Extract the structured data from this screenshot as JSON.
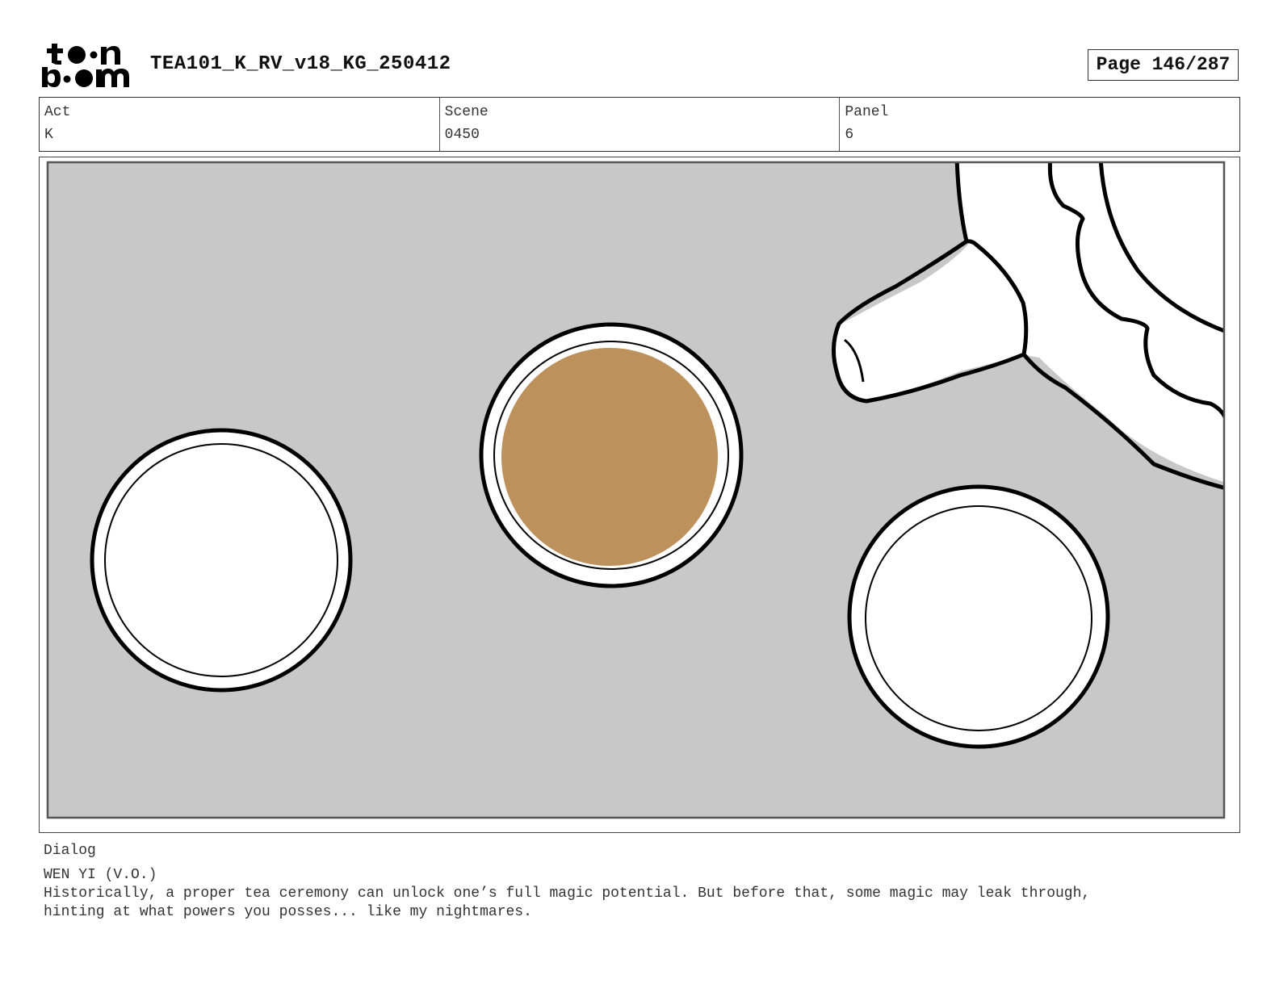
{
  "header": {
    "logo_text": "toon boom",
    "document_title": "TEA101_K_RV_v18_KG_250412",
    "page_indicator": "Page 146/287"
  },
  "info_table": {
    "act": {
      "label": "Act",
      "value": "K"
    },
    "scene": {
      "label": "Scene",
      "value": "0450"
    },
    "panel": {
      "label": "Panel",
      "value": "6"
    }
  },
  "panel_image": {
    "background_color": "#c8c8c8",
    "tea_color": "#bc915b",
    "line_color": "#000000"
  },
  "dialog": {
    "label": "Dialog",
    "speaker": "WEN YI (V.O.)",
    "text": "Historically, a proper tea ceremony can unlock one’s full magic potential. But before that, some magic may leak through,\nhinting at what powers you posses... like my nightmares."
  }
}
